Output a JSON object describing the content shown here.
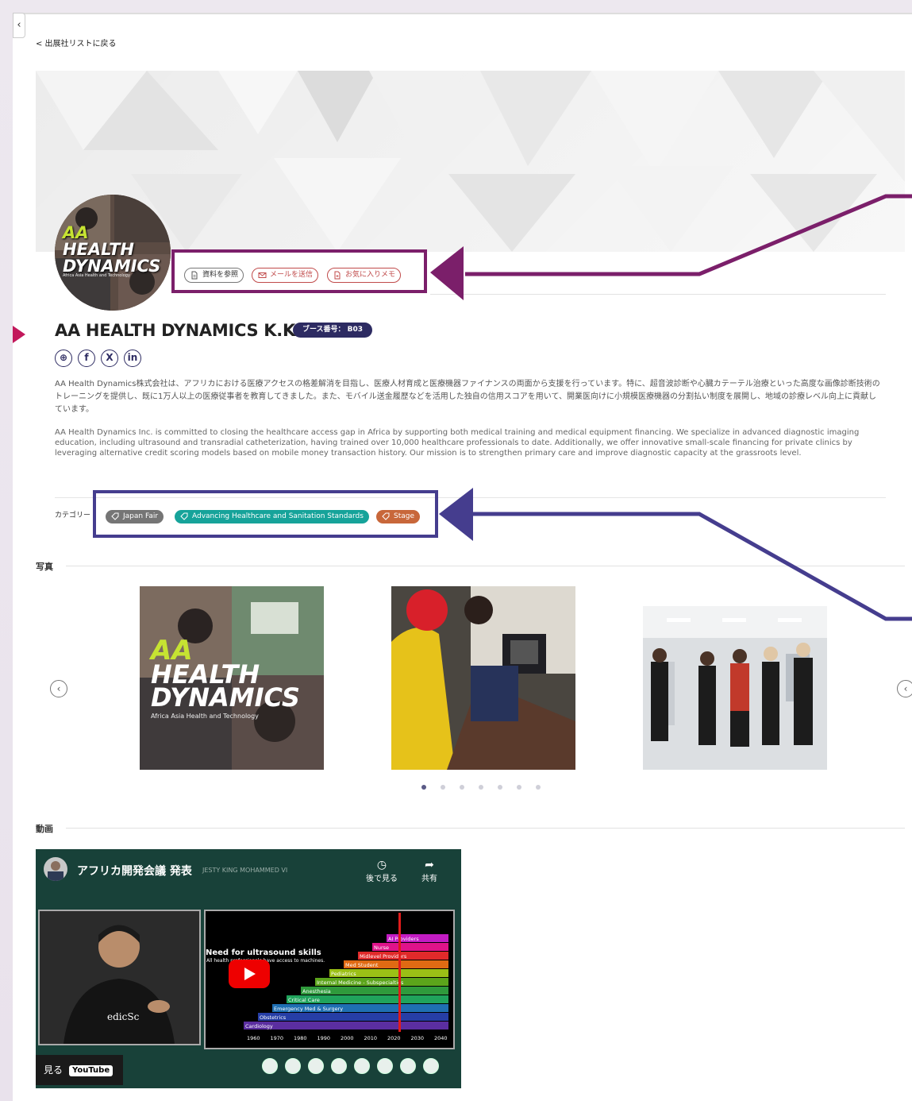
{
  "nav": {
    "collapse_glyph": "‹",
    "back_link": "< 出展社リストに戻る"
  },
  "actions": [
    {
      "label": "資料を参照",
      "icon": "document-icon"
    },
    {
      "label": "メールを送信",
      "icon": "mail-icon"
    },
    {
      "label": "お気に入りメモ",
      "icon": "memo-icon"
    }
  ],
  "logo": {
    "line1": "AA",
    "line2": "HEALTH",
    "line3": "DYNAMICS",
    "sub": "Africa Asia Health and Technology"
  },
  "company": {
    "name": "AA HEALTH DYNAMICS K.K",
    "booth": "ブース番号： B03"
  },
  "socials": [
    {
      "name": "website",
      "glyph": "⊕"
    },
    {
      "name": "facebook",
      "glyph": "f"
    },
    {
      "name": "x",
      "glyph": "X"
    },
    {
      "name": "linkedin",
      "glyph": "in"
    }
  ],
  "description": {
    "jp": "AA Health Dynamics株式会社は、アフリカにおける医療アクセスの格差解消を目指し、医療人材育成と医療機器ファイナンスの両面から支援を行っています。特に、超音波診断や心臓カテーテル治療といった高度な画像診断技術のトレーニングを提供し、既に1万人以上の医療従事者を教育してきました。また、モバイル送金履歴などを活用した独自の信用スコアを用いて、開業医向けに小規模医療機器の分割払い制度を展開し、地域の診療レベル向上に貢献しています。",
    "en": "AA Health Dynamics Inc. is committed to closing the healthcare access gap in Africa by supporting both medical training and medical equipment financing. We specialize in advanced diagnostic imaging education, including ultrasound and transradial catheterization, having trained over 10,000 healthcare professionals to date. Additionally, we offer innovative small-scale financing for private clinics by leveraging alternative credit scoring models based on mobile money transaction history. Our mission is to strengthen primary care and improve diagnostic capacity at the grassroots level."
  },
  "categories": {
    "label": "カテゴリー",
    "items": [
      {
        "label": "Japan Fair",
        "color": "#757575"
      },
      {
        "label": "Advancing Healthcare and Sanitation Standards",
        "color": "#16a39a"
      },
      {
        "label": "Stage",
        "color": "#c8673a"
      }
    ]
  },
  "photos": {
    "title": "写真",
    "prev_glyph": "‹",
    "next_glyph": "‹",
    "slides_count": 7,
    "active_index": 0,
    "photo1_text": {
      "line1": "AA",
      "line2": "HEALTH",
      "line3": "DYNAMICS",
      "sub": "Africa Asia Health and Technology"
    }
  },
  "video": {
    "section_title": "動画",
    "title": "アフリカ開発会議 発表",
    "ghost_title": "JESTY KING MOHAMMED VI",
    "watch_later": "後で見る",
    "share": "共有",
    "watch_on": "見る",
    "youtube": "YouTube",
    "shirt_text": "edicSc",
    "slide": {
      "title": "Need for ultrasound skills",
      "sub": "All health professionals have access to machines.",
      "rows": [
        {
          "label": "AI Providers",
          "color": "#c31cc3"
        },
        {
          "label": "Nurse",
          "color": "#e0138a"
        },
        {
          "label": "Midlevel Providers",
          "color": "#e02a2a"
        },
        {
          "label": "Med Student",
          "color": "#e06a13"
        },
        {
          "label": "Pediatrics",
          "color": "#9bc016"
        },
        {
          "label": "Internal Medicine - Subspecialties",
          "color": "#5ca51b"
        },
        {
          "label": "Anesthesia",
          "color": "#2f9a3c"
        },
        {
          "label": "Critical Care",
          "color": "#20a35c"
        },
        {
          "label": "Emergency Med & Surgery",
          "color": "#1f6fb2"
        },
        {
          "label": "Obstetrics",
          "color": "#263ea6"
        },
        {
          "label": "Cardiology",
          "color": "#5b2ea0"
        }
      ],
      "years": [
        "1960",
        "1970",
        "1980",
        "1990",
        "2000",
        "2010",
        "2020",
        "2030",
        "2040"
      ]
    }
  },
  "colors": {
    "accent_purple": "#7b1f6a",
    "accent_indigo": "#453d8e",
    "badge": "#2d2b62"
  }
}
